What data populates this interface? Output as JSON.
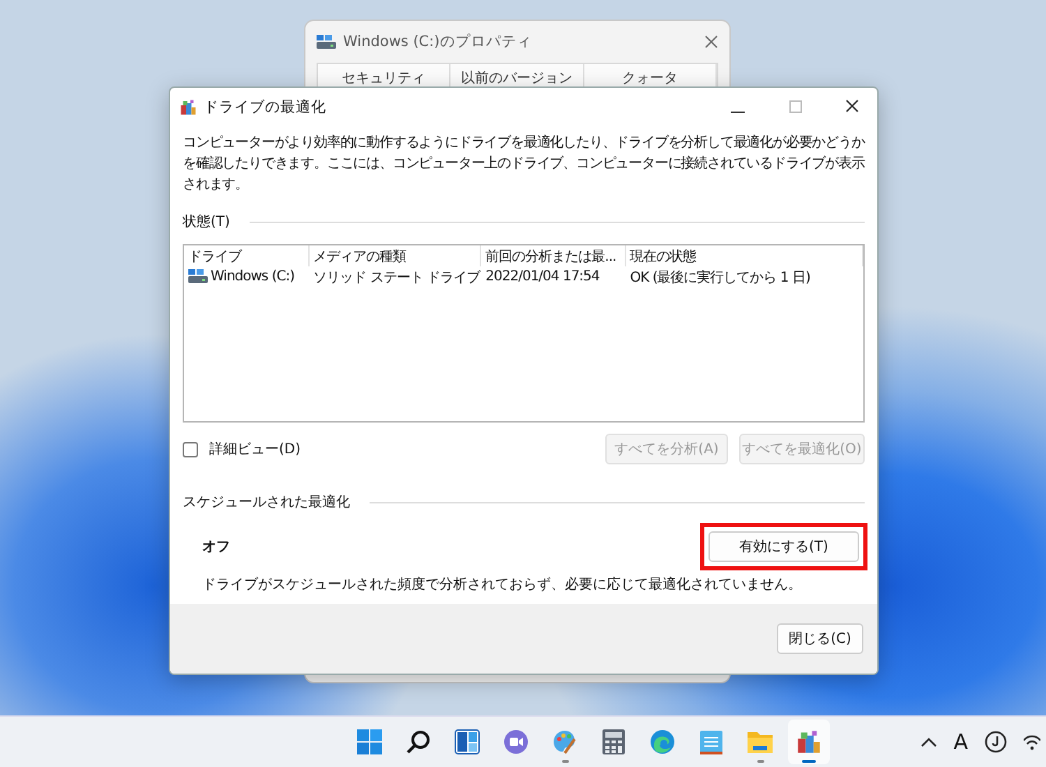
{
  "background_window": {
    "title": "Windows (C:)のプロパティ",
    "tabs": [
      "セキュリティ",
      "以前のバージョン",
      "クォータ"
    ]
  },
  "window": {
    "title": "ドライブの最適化",
    "description": "コンピューターがより効率的に動作するようにドライブを最適化したり、ドライブを分析して最適化が必要かどうかを確認したりできます。ここには、コンピューター上のドライブ、コンピューターに接続されているドライブが表示されます。",
    "status_section": {
      "label": "状態(T)",
      "columns": [
        "ドライブ",
        "メディアの種類",
        "前回の分析または最...",
        "現在の状態"
      ],
      "rows": [
        {
          "cells": [
            "Windows (C:)",
            "ソリッド ステート ドライブ",
            "2022/01/04 17:54",
            "OK (最後に実行してから 1 日)"
          ],
          "selected": false
        }
      ]
    },
    "detail_view": {
      "label": "詳細ビュー(D)",
      "checked": false
    },
    "buttons": [
      {
        "label": "すべてを分析(A)",
        "disabled": true
      },
      {
        "label": "すべてを最適化(O)",
        "disabled": true
      }
    ],
    "schedule_section": {
      "label": "スケジュールされた最適化",
      "state": "オフ",
      "description": "ドライブがスケジュールされた頻度で分析されておらず、必要に応じて最適化されていません。",
      "button": {
        "label": "有効にする(T)",
        "highlighted": true
      }
    },
    "close_button": "閉じる(C)"
  },
  "taskbar": {
    "apps": [
      {
        "kind": "start",
        "running": false,
        "active": false
      },
      {
        "kind": "search",
        "running": false,
        "active": false
      },
      {
        "kind": "widgets",
        "running": false,
        "active": false
      },
      {
        "kind": "chat",
        "running": false,
        "active": false
      },
      {
        "kind": "paint",
        "running": true,
        "active": false
      },
      {
        "kind": "calculator",
        "running": false,
        "active": false
      },
      {
        "kind": "browser",
        "running": false,
        "active": false
      },
      {
        "kind": "notepad",
        "running": false,
        "active": false
      },
      {
        "kind": "folder",
        "running": true,
        "active": false
      },
      {
        "kind": "defrag",
        "running": true,
        "active": true
      }
    ],
    "ime": "A"
  }
}
